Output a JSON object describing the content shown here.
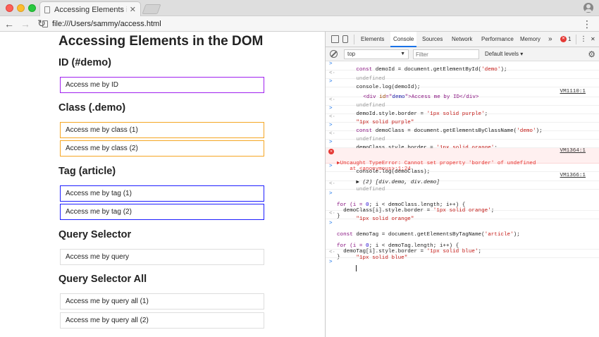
{
  "browser": {
    "tab_title": "Accessing Elements in the DOM",
    "url": "file:///Users/sammy/access.html"
  },
  "page": {
    "title": "Accessing Elements in the DOM",
    "sections": [
      {
        "heading": "ID (#demo)",
        "boxes": [
          "Access me by ID"
        ]
      },
      {
        "heading": "Class (.demo)",
        "boxes": [
          "Access me by class (1)",
          "Access me by class (2)"
        ]
      },
      {
        "heading": "Tag (article)",
        "boxes": [
          "Access me by tag (1)",
          "Access me by tag (2)"
        ]
      },
      {
        "heading": "Query Selector",
        "boxes": [
          "Access me by query"
        ]
      },
      {
        "heading": "Query Selector All",
        "boxes": [
          "Access me by query all (1)",
          "Access me by query all (2)"
        ]
      }
    ],
    "colors": {
      "purple": "#a020f0",
      "orange": "#f5a623",
      "blue": "#1f1fff"
    }
  },
  "devtools": {
    "tabs": [
      "Elements",
      "Console",
      "Sources",
      "Network",
      "Performance",
      "Memory"
    ],
    "active_tab": "Console",
    "more_label": "»",
    "error_count": "1",
    "context": "top",
    "filter_placeholder": "Filter",
    "levels": "Default levels",
    "console": {
      "l1_a": "const ",
      "l1_b": "demoId",
      "l1_c": " = document.getElementById(",
      "l1_d": "'demo'",
      "l1_e": ");",
      "l2": "undefined",
      "l3": "console.log(demoId);",
      "l4_a": "<div ",
      "l4_b": "id",
      "l4_c": "=\"",
      "l4_d": "demo",
      "l4_e": "\">Access me by ID</div>",
      "l4_src": "VM1110:1",
      "l5": "undefined",
      "l6_a": "demoId.style.border = ",
      "l6_b": "'1px solid purple'",
      "l6_c": ";",
      "l7": "\"1px solid purple\"",
      "l8_a": "const ",
      "l8_b": "demoClass",
      "l8_c": " = document.getElementsByClassName(",
      "l8_d": "'demo'",
      "l8_e": ");",
      "l9": "undefined",
      "l10_a": "demoClass.style.border = ",
      "l10_b": "'1px solid orange'",
      "l10_c": ";",
      "l11_a": "▶Uncaught TypeError: Cannot set property 'border' of undefined",
      "l11_b": "    at <anonymous>:1:24",
      "l11_src": "VM1364:1",
      "l12": "console.log(demoClass);",
      "l13_a": "▶ (2) [",
      "l13_b": "div.demo, div.demo",
      "l13_c": "]",
      "l13_src": "VM1366:1",
      "l14": "undefined",
      "l15_a": "for (i = ",
      "l15_b": "0",
      "l15_c": "; i < demoClass.length; i++) {",
      "l15_d": "  demoClass[i].style.border = ",
      "l15_e": "'1px solid orange'",
      "l15_f": ";",
      "l15_g": "}",
      "l16": "\"1px solid orange\"",
      "l17_a": "const ",
      "l17_b": "demoTag",
      "l17_c": " = document.getElementsByTagName(",
      "l17_d": "'article'",
      "l17_e": ");",
      "l17_f": "for (i = ",
      "l17_g": "0",
      "l17_h": "; i < demoTag.length; i++) {",
      "l17_i": "  demoTag[i].style.border = ",
      "l17_j": "'1px solid blue'",
      "l17_k": ";",
      "l17_l": "}",
      "l18": "\"1px solid blue\""
    }
  }
}
